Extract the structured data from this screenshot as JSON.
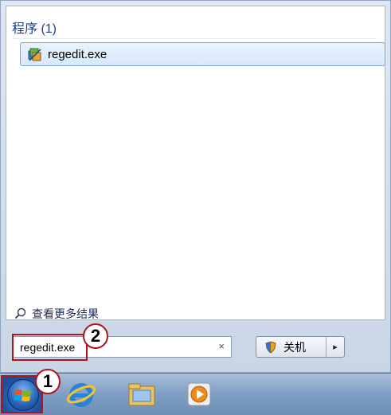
{
  "start_menu": {
    "group_header": "程序 (1)",
    "results": [
      {
        "label": "regedit.exe",
        "icon": "regedit-icon"
      }
    ],
    "see_more": "查看更多结果",
    "search": {
      "value": "regedit.exe",
      "clear_icon": "×"
    },
    "shutdown": {
      "label": "关机",
      "arrow": "▸"
    }
  },
  "callouts": {
    "one": "1",
    "two": "2"
  },
  "taskbar": {
    "icons": [
      "windows-start-orb-icon",
      "internet-explorer-icon",
      "windows-explorer-icon",
      "media-player-icon"
    ]
  },
  "colors": {
    "highlight_red": "#b5121b",
    "header_blue": "#1e3f8c",
    "taskbar_blue": "#7f9ec4"
  }
}
